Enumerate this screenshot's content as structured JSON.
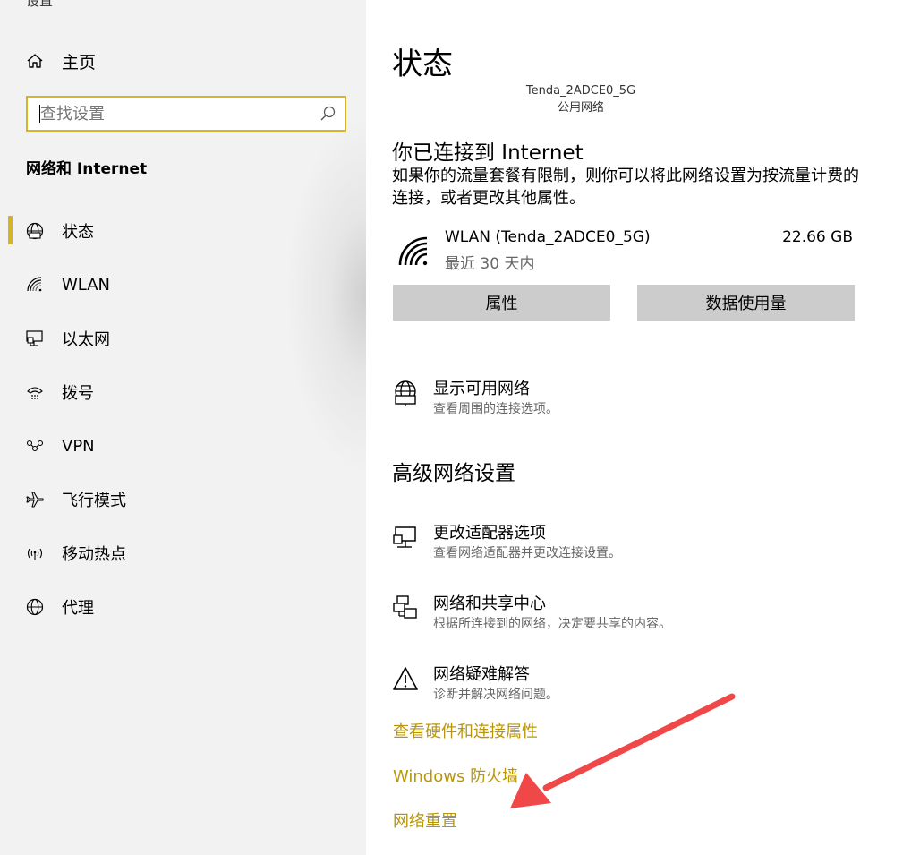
{
  "sidebar": {
    "app_title": "设置",
    "home_label": "主页",
    "search_placeholder": "查找设置",
    "section_title": "网络和 Internet",
    "items": [
      {
        "label": "状态",
        "icon": "globe-icon",
        "active": true
      },
      {
        "label": "WLAN",
        "icon": "wifi-icon"
      },
      {
        "label": "以太网",
        "icon": "ethernet-icon"
      },
      {
        "label": "拨号",
        "icon": "dialup-icon"
      },
      {
        "label": "VPN",
        "icon": "vpn-icon"
      },
      {
        "label": "飞行模式",
        "icon": "airplane-icon"
      },
      {
        "label": "移动热点",
        "icon": "hotspot-icon"
      },
      {
        "label": "代理",
        "icon": "globe-icon"
      }
    ]
  },
  "main": {
    "title": "状态",
    "network_name": "Tenda_2ADCE0_5G",
    "network_type": "公用网络",
    "connected_heading": "你已连接到 Internet",
    "connected_desc": "如果你的流量套餐有限制，则你可以将此网络设置为按流量计费的连接，或者更改其他属性。",
    "wlan": {
      "name": "WLAN (Tenda_2ADCE0_5G)",
      "period": "最近 30 天内",
      "usage": "22.66 GB"
    },
    "buttons": {
      "properties": "属性",
      "data_usage": "数据使用量"
    },
    "show_networks": {
      "title": "显示可用网络",
      "subtitle": "查看周围的连接选项。"
    },
    "advanced_heading": "高级网络设置",
    "advanced_items": [
      {
        "title": "更改适配器选项",
        "subtitle": "查看网络适配器并更改连接设置。",
        "icon": "adapter-icon"
      },
      {
        "title": "网络和共享中心",
        "subtitle": "根据所连接到的网络，决定要共享的内容。",
        "icon": "sharing-center-icon"
      },
      {
        "title": "网络疑难解答",
        "subtitle": "诊断并解决网络问题。",
        "icon": "warning-icon"
      }
    ],
    "links": {
      "hardware": "查看硬件和连接属性",
      "firewall": "Windows 防火墙",
      "reset": "网络重置"
    }
  },
  "colors": {
    "accent": "#d4b52a",
    "link": "#b8960c",
    "annotation_arrow": "#f04848",
    "button_bg": "#cccccc",
    "sidebar_bg": "#f2f2f2"
  }
}
